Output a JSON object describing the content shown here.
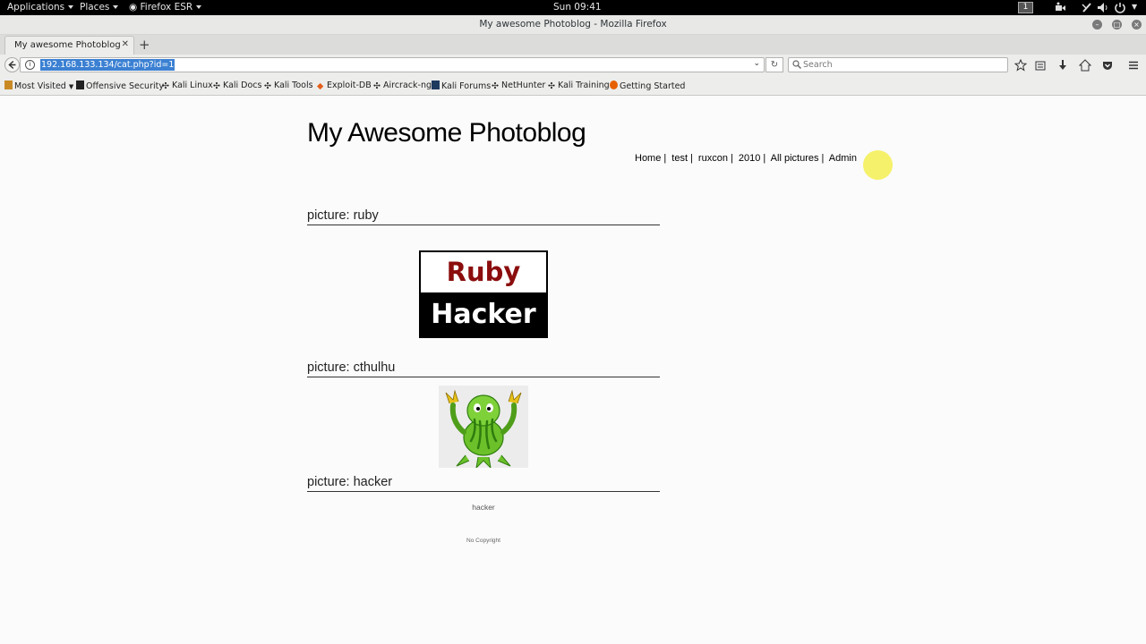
{
  "topbar": {
    "applications": "Applications",
    "places": "Places",
    "firefox": "Firefox ESR",
    "clock": "Sun 09:41",
    "workspace": "1"
  },
  "window": {
    "title": "My awesome Photoblog - Mozilla Firefox"
  },
  "tab": {
    "title": "My awesome Photoblog"
  },
  "navbar": {
    "url": "192.168.133.134/cat.php?id=1",
    "search_placeholder": "Search"
  },
  "bookmarks": [
    {
      "label": "Most Visited",
      "icon": "folder-icon"
    },
    {
      "label": "Offensive Security",
      "icon": "offsec-icon"
    },
    {
      "label": "Kali Linux",
      "icon": "kali-dragon-icon"
    },
    {
      "label": "Kali Docs",
      "icon": "kali-dragon-icon"
    },
    {
      "label": "Kali Tools",
      "icon": "kali-dragon-icon"
    },
    {
      "label": "Exploit-DB",
      "icon": "exploitdb-icon"
    },
    {
      "label": "Aircrack-ng",
      "icon": "aircrack-icon"
    },
    {
      "label": "Kali Forums",
      "icon": "forums-icon"
    },
    {
      "label": "NetHunter",
      "icon": "kali-dragon-icon"
    },
    {
      "label": "Kali Training",
      "icon": "kali-dragon-icon"
    },
    {
      "label": "Getting Started",
      "icon": "firefox-icon"
    }
  ],
  "page": {
    "site_title": "My Awesome Photoblog",
    "nav": [
      "Home",
      "test",
      "ruxcon",
      "2010",
      "All pictures",
      "Admin"
    ],
    "pictures": [
      {
        "heading": "picture: ruby"
      },
      {
        "heading": "picture: cthulhu"
      },
      {
        "heading": "picture: hacker",
        "alt_text": "hacker"
      }
    ],
    "ruby_image": {
      "top": "Ruby",
      "bottom": "Hacker"
    },
    "footer": "No Copyright"
  },
  "colors": {
    "url_selection": "#3b80d2",
    "ruby_red": "#8b0d0d",
    "cursor_highlight": "#f5ee50"
  }
}
